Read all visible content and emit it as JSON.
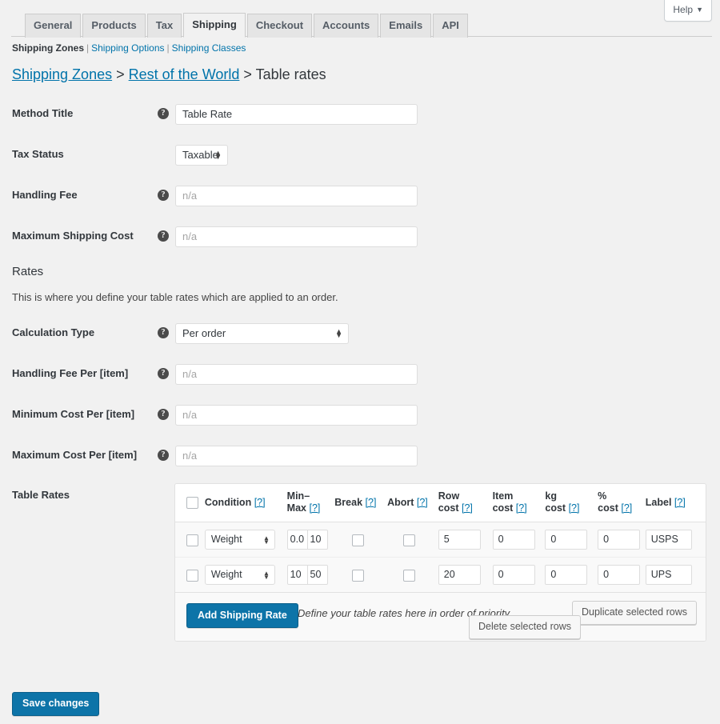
{
  "help": {
    "label": "Help",
    "caret": "▼"
  },
  "tabs": [
    {
      "label": "General",
      "active": false
    },
    {
      "label": "Products",
      "active": false
    },
    {
      "label": "Tax",
      "active": false
    },
    {
      "label": "Shipping",
      "active": true
    },
    {
      "label": "Checkout",
      "active": false
    },
    {
      "label": "Accounts",
      "active": false
    },
    {
      "label": "Emails",
      "active": false
    },
    {
      "label": "API",
      "active": false
    }
  ],
  "subnav": {
    "items": [
      {
        "label": "Shipping Zones",
        "current": true
      },
      {
        "label": "Shipping Options",
        "current": false
      },
      {
        "label": "Shipping Classes",
        "current": false
      }
    ],
    "separator": "|"
  },
  "breadcrumb": {
    "root": "Shipping Zones",
    "sep1": ">",
    "zone": "Rest of the World",
    "sep2": ">",
    "current": "Table rates"
  },
  "settings": [
    {
      "label": "Method Title",
      "help": "?",
      "type": "text",
      "value": "Table Rate",
      "placeholder": ""
    },
    {
      "label": "Tax Status",
      "help": "",
      "type": "select",
      "value": "Taxable"
    },
    {
      "label": "Handling Fee",
      "help": "?",
      "type": "text",
      "value": "",
      "placeholder": "n/a"
    },
    {
      "label": "Maximum Shipping Cost",
      "help": "?",
      "type": "text",
      "value": "",
      "placeholder": "n/a"
    }
  ],
  "rates_section": {
    "title": "Rates",
    "description": "This is where you define your table rates which are applied to an order."
  },
  "rate_settings": [
    {
      "label": "Calculation Type",
      "help": "?",
      "type": "select",
      "value": "Per order"
    },
    {
      "label": "Handling Fee Per [item]",
      "help": "?",
      "type": "text",
      "value": "",
      "placeholder": "n/a"
    },
    {
      "label": "Minimum Cost Per [item]",
      "help": "?",
      "type": "text",
      "value": "",
      "placeholder": "n/a"
    },
    {
      "label": "Maximum Cost Per [item]",
      "help": "?",
      "type": "text",
      "value": "",
      "placeholder": "n/a"
    }
  ],
  "table_rates": {
    "label": "Table Rates",
    "hint_token": "[?]",
    "columns": [
      {
        "key": "select",
        "label": ""
      },
      {
        "key": "condition",
        "label": "Condition"
      },
      {
        "key": "minmax",
        "label_line1": "Min–",
        "label_line2": "Max"
      },
      {
        "key": "break",
        "label": "Break"
      },
      {
        "key": "abort",
        "label": "Abort"
      },
      {
        "key": "row_cost",
        "label_line1": "Row",
        "label_line2": "cost"
      },
      {
        "key": "item_cost",
        "label_line1": "Item",
        "label_line2": "cost"
      },
      {
        "key": "kg_cost",
        "label_line1": "kg",
        "label_line2": "cost"
      },
      {
        "key": "pct_cost",
        "label_line1": "%",
        "label_line2": "cost"
      },
      {
        "key": "label",
        "label": "Label"
      }
    ],
    "rows": [
      {
        "selected": false,
        "condition": "Weight",
        "min": "0.0",
        "max": "10",
        "break": false,
        "abort": false,
        "row_cost": "5",
        "item_cost": "0",
        "kg_cost": "0",
        "pct_cost": "0",
        "label": "USPS"
      },
      {
        "selected": false,
        "condition": "Weight",
        "min": "10",
        "max": "50",
        "break": false,
        "abort": false,
        "row_cost": "20",
        "item_cost": "0",
        "kg_cost": "0",
        "pct_cost": "0",
        "label": "UPS"
      }
    ],
    "footer": {
      "add_label": "Add Shipping Rate",
      "note": "Define your table rates here in order of priority.",
      "duplicate_label": "Duplicate selected rows",
      "delete_label": "Delete selected rows"
    }
  },
  "save": {
    "label": "Save changes"
  },
  "colors": {
    "accent": "#0073aa",
    "button": "#0d74a8",
    "page_bg": "#f1f1f1",
    "text": "#32373c"
  }
}
